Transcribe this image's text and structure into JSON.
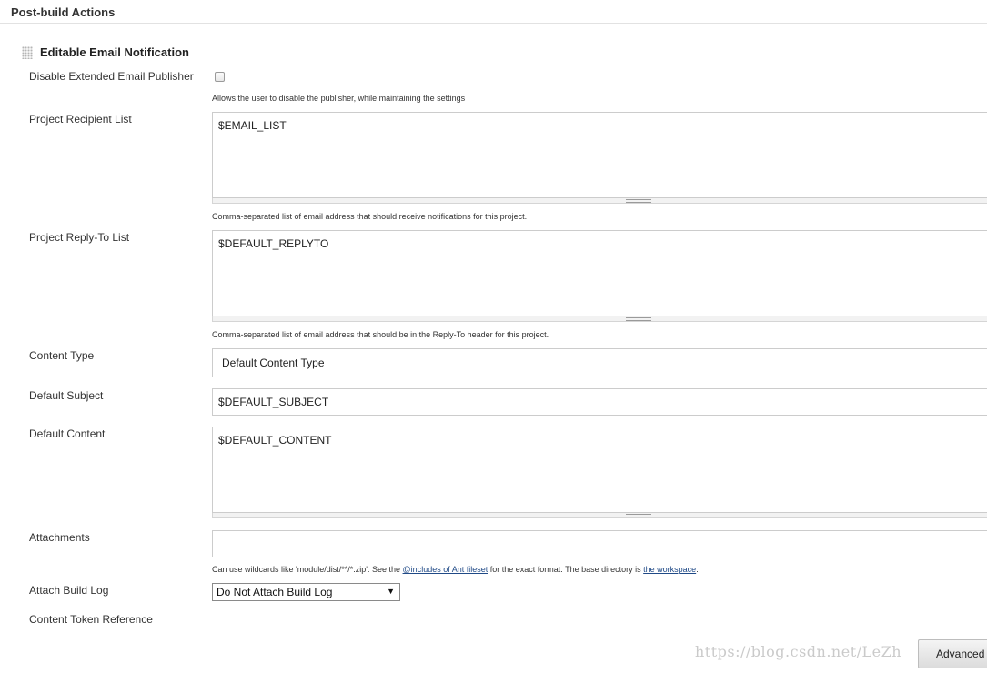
{
  "section": {
    "title": "Post-build Actions"
  },
  "block": {
    "title": "Editable Email Notification"
  },
  "fields": {
    "disable_publisher": {
      "label": "Disable Extended Email Publisher",
      "help": "Allows the user to disable the publisher, while maintaining the settings",
      "checked": false
    },
    "recipient_list": {
      "label": "Project Recipient List",
      "value": "$EMAIL_LIST",
      "help": "Comma-separated list of email address that should receive notifications for this project."
    },
    "reply_to": {
      "label": "Project Reply-To List",
      "value": "$DEFAULT_REPLYTO",
      "help": "Comma-separated list of email address that should be in the Reply-To header for this project."
    },
    "content_type": {
      "label": "Content Type",
      "value": "Default Content Type"
    },
    "default_subject": {
      "label": "Default Subject",
      "value": "$DEFAULT_SUBJECT"
    },
    "default_content": {
      "label": "Default Content",
      "value": "$DEFAULT_CONTENT"
    },
    "attachments": {
      "label": "Attachments",
      "value": "",
      "help_prefix": "Can use wildcards like 'module/dist/**/*.zip'. See the ",
      "help_link1": "@includes of Ant fileset",
      "help_middle": " for the exact format. The base directory is ",
      "help_link2": "the workspace",
      "help_suffix": "."
    },
    "attach_build_log": {
      "label": "Attach Build Log",
      "value": "Do Not Attach Build Log",
      "arrow": "▼"
    },
    "content_token_reference": {
      "label": "Content Token Reference"
    }
  },
  "advanced_button": {
    "label": "Advanced"
  },
  "watermark": "https://blog.csdn.net/LeZh",
  "icons": {
    "drag_handle": "drag-handle-icon",
    "dropdown_arrow": "chevron-down-icon"
  }
}
